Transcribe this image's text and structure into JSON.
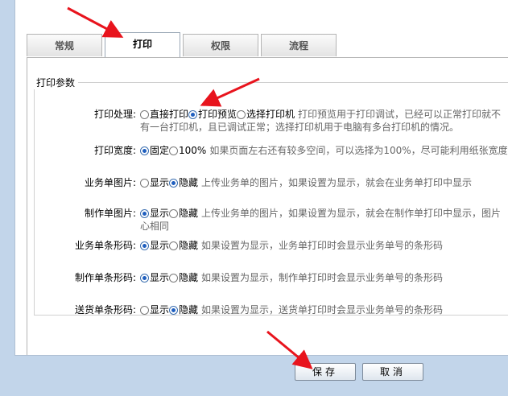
{
  "tabs": [
    "常规",
    "打印",
    "权限",
    "流程"
  ],
  "active_tab": 1,
  "section_title": "打印参数",
  "rows": [
    {
      "label": "打印处理:",
      "options": [
        {
          "text": "直接打印",
          "checked": false
        },
        {
          "text": "打印预览",
          "checked": true
        },
        {
          "text": "选择打印机",
          "checked": false
        }
      ],
      "hint": "打印预览用于打印调试，已经可以正常打印就不",
      "hint2": "有一台打印机，且已调试正常；选择打印机用于电脑有多台打印机的情况。"
    },
    {
      "label": "打印宽度:",
      "options": [
        {
          "text": "固定",
          "checked": true
        },
        {
          "text": "100%",
          "checked": false
        }
      ],
      "hint": "如果页面左右还有较多空间，可以选择为100%，尽可能利用纸张宽度"
    },
    {
      "label": "业务单图片:",
      "options": [
        {
          "text": "显示",
          "checked": false
        },
        {
          "text": "隐藏",
          "checked": true
        }
      ],
      "hint": "上传业务单的图片，如果设置为显示，就会在业务单打印中显示"
    },
    {
      "label": "制作单图片:",
      "options": [
        {
          "text": "显示",
          "checked": true
        },
        {
          "text": "隐藏",
          "checked": false
        }
      ],
      "hint": "上传业务单的图片，如果设置为显示，就会在制作单打印中显示，图片",
      "hint2": "心相同"
    },
    {
      "label": "业务单条形码:",
      "options": [
        {
          "text": "显示",
          "checked": true
        },
        {
          "text": "隐藏",
          "checked": false
        }
      ],
      "hint": "如果设置为显示，业务单打印时会显示业务单号的条形码"
    },
    {
      "label": "制作单条形码:",
      "options": [
        {
          "text": "显示",
          "checked": true
        },
        {
          "text": "隐藏",
          "checked": false
        }
      ],
      "hint": "如果设置为显示，制作单打印时会显示业务单号的条形码"
    },
    {
      "label": "送货单条形码:",
      "options": [
        {
          "text": "显示",
          "checked": false
        },
        {
          "text": "隐藏",
          "checked": true
        }
      ],
      "hint": "如果设置为显示，送货单打印时会显示业务单号的条形码"
    }
  ],
  "buttons": {
    "save": "保存",
    "cancel": "取消"
  },
  "colors": {
    "accent": "#1f5fbf",
    "arrow": "#e8141d"
  }
}
